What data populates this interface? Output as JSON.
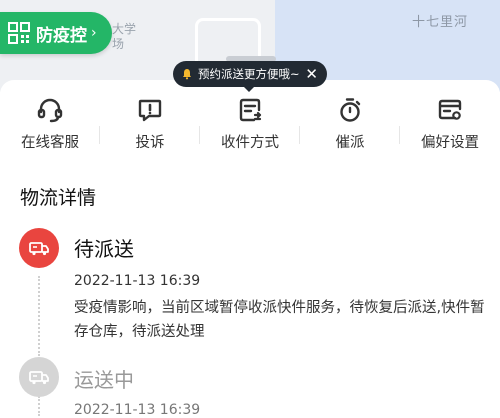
{
  "map": {
    "poi_label_1": "大学",
    "poi_label_2": "场",
    "river_label": "十七里河"
  },
  "epidemic_button": {
    "label": "防疫控",
    "icon": "qr-code-icon",
    "color": "#24b667"
  },
  "tooltip": {
    "text": "预约派送更方便哦~",
    "icon": "bell-icon"
  },
  "actions": [
    {
      "label": "在线客服",
      "icon": "headset-icon"
    },
    {
      "label": "投诉",
      "icon": "complaint-icon"
    },
    {
      "label": "收件方式",
      "icon": "receive-method-icon"
    },
    {
      "label": "催派",
      "icon": "urge-icon"
    },
    {
      "label": "偏好设置",
      "icon": "preference-settings-icon"
    }
  ],
  "logistics": {
    "title": "物流详情",
    "events": [
      {
        "status": "待派送",
        "time": "2022-11-13 16:39",
        "description": "受疫情影响，当前区域暂停收派快件服务，待恢复后派送,快件暂存仓库，待派送处理",
        "icon": "truck-icon",
        "color": "#e9453f"
      },
      {
        "status": "运送中",
        "time": "2022-11-13 16:39",
        "icon": "truck-icon",
        "color": "#d5d5d5"
      }
    ]
  }
}
